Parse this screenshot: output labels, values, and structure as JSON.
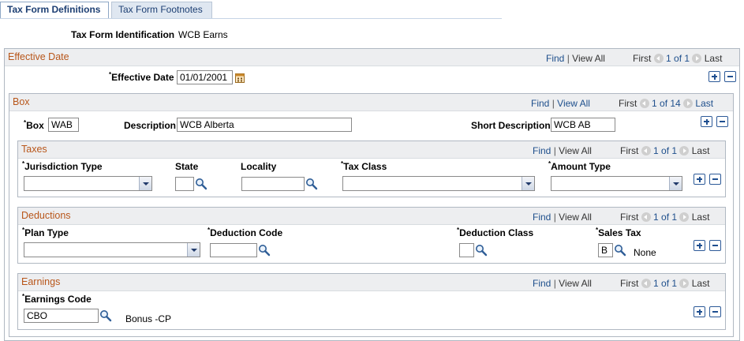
{
  "tabs": [
    {
      "label": "Tax Form Definitions",
      "active": true
    },
    {
      "label": "Tax Form Footnotes",
      "active": false
    }
  ],
  "header": {
    "tax_form_id_label": "Tax Form Identification",
    "tax_form_id_value": "WCB Earns"
  },
  "nav_text": {
    "find": "Find",
    "view_all": "View All",
    "first": "First",
    "last": "Last",
    "sep": "|"
  },
  "effective_date": {
    "title": "Effective Date",
    "page_indicator": "1 of 1",
    "label": "Effective Date",
    "value": "01/01/2001"
  },
  "box": {
    "title": "Box",
    "page_indicator": "1 of 14",
    "box_label": "Box",
    "box_value": "WAB",
    "description_label": "Description",
    "description_value": "WCB Alberta",
    "short_description_label": "Short Description",
    "short_description_value": "WCB AB"
  },
  "taxes": {
    "title": "Taxes",
    "page_indicator": "1 of 1",
    "jurisdiction_type_label": "Jurisdiction Type",
    "state_label": "State",
    "locality_label": "Locality",
    "tax_class_label": "Tax Class",
    "amount_type_label": "Amount Type",
    "jurisdiction_type_value": "",
    "state_value": "",
    "locality_value": "",
    "tax_class_value": "",
    "amount_type_value": ""
  },
  "deductions": {
    "title": "Deductions",
    "page_indicator": "1 of 1",
    "plan_type_label": "Plan Type",
    "deduction_code_label": "Deduction Code",
    "deduction_class_label": "Deduction Class",
    "sales_tax_label": "Sales Tax",
    "plan_type_value": "",
    "deduction_code_value": "",
    "deduction_class_value": "",
    "sales_tax_value": "B",
    "sales_tax_desc": "None"
  },
  "earnings": {
    "title": "Earnings",
    "page_indicator": "1 of 1",
    "earnings_code_label": "Earnings Code",
    "earnings_code_value": "CBO",
    "earnings_code_desc": "Bonus -CP"
  },
  "colors": {
    "section_title": "#b8561a",
    "link": "#1e4f8c",
    "tab_active_text": "#1d3f73"
  },
  "icons": {
    "lookup": "magnifier-icon",
    "calendar": "calendar-icon",
    "add": "plus-icon",
    "delete": "minus-icon",
    "prev": "arrow-left-icon",
    "next": "arrow-right-icon"
  }
}
